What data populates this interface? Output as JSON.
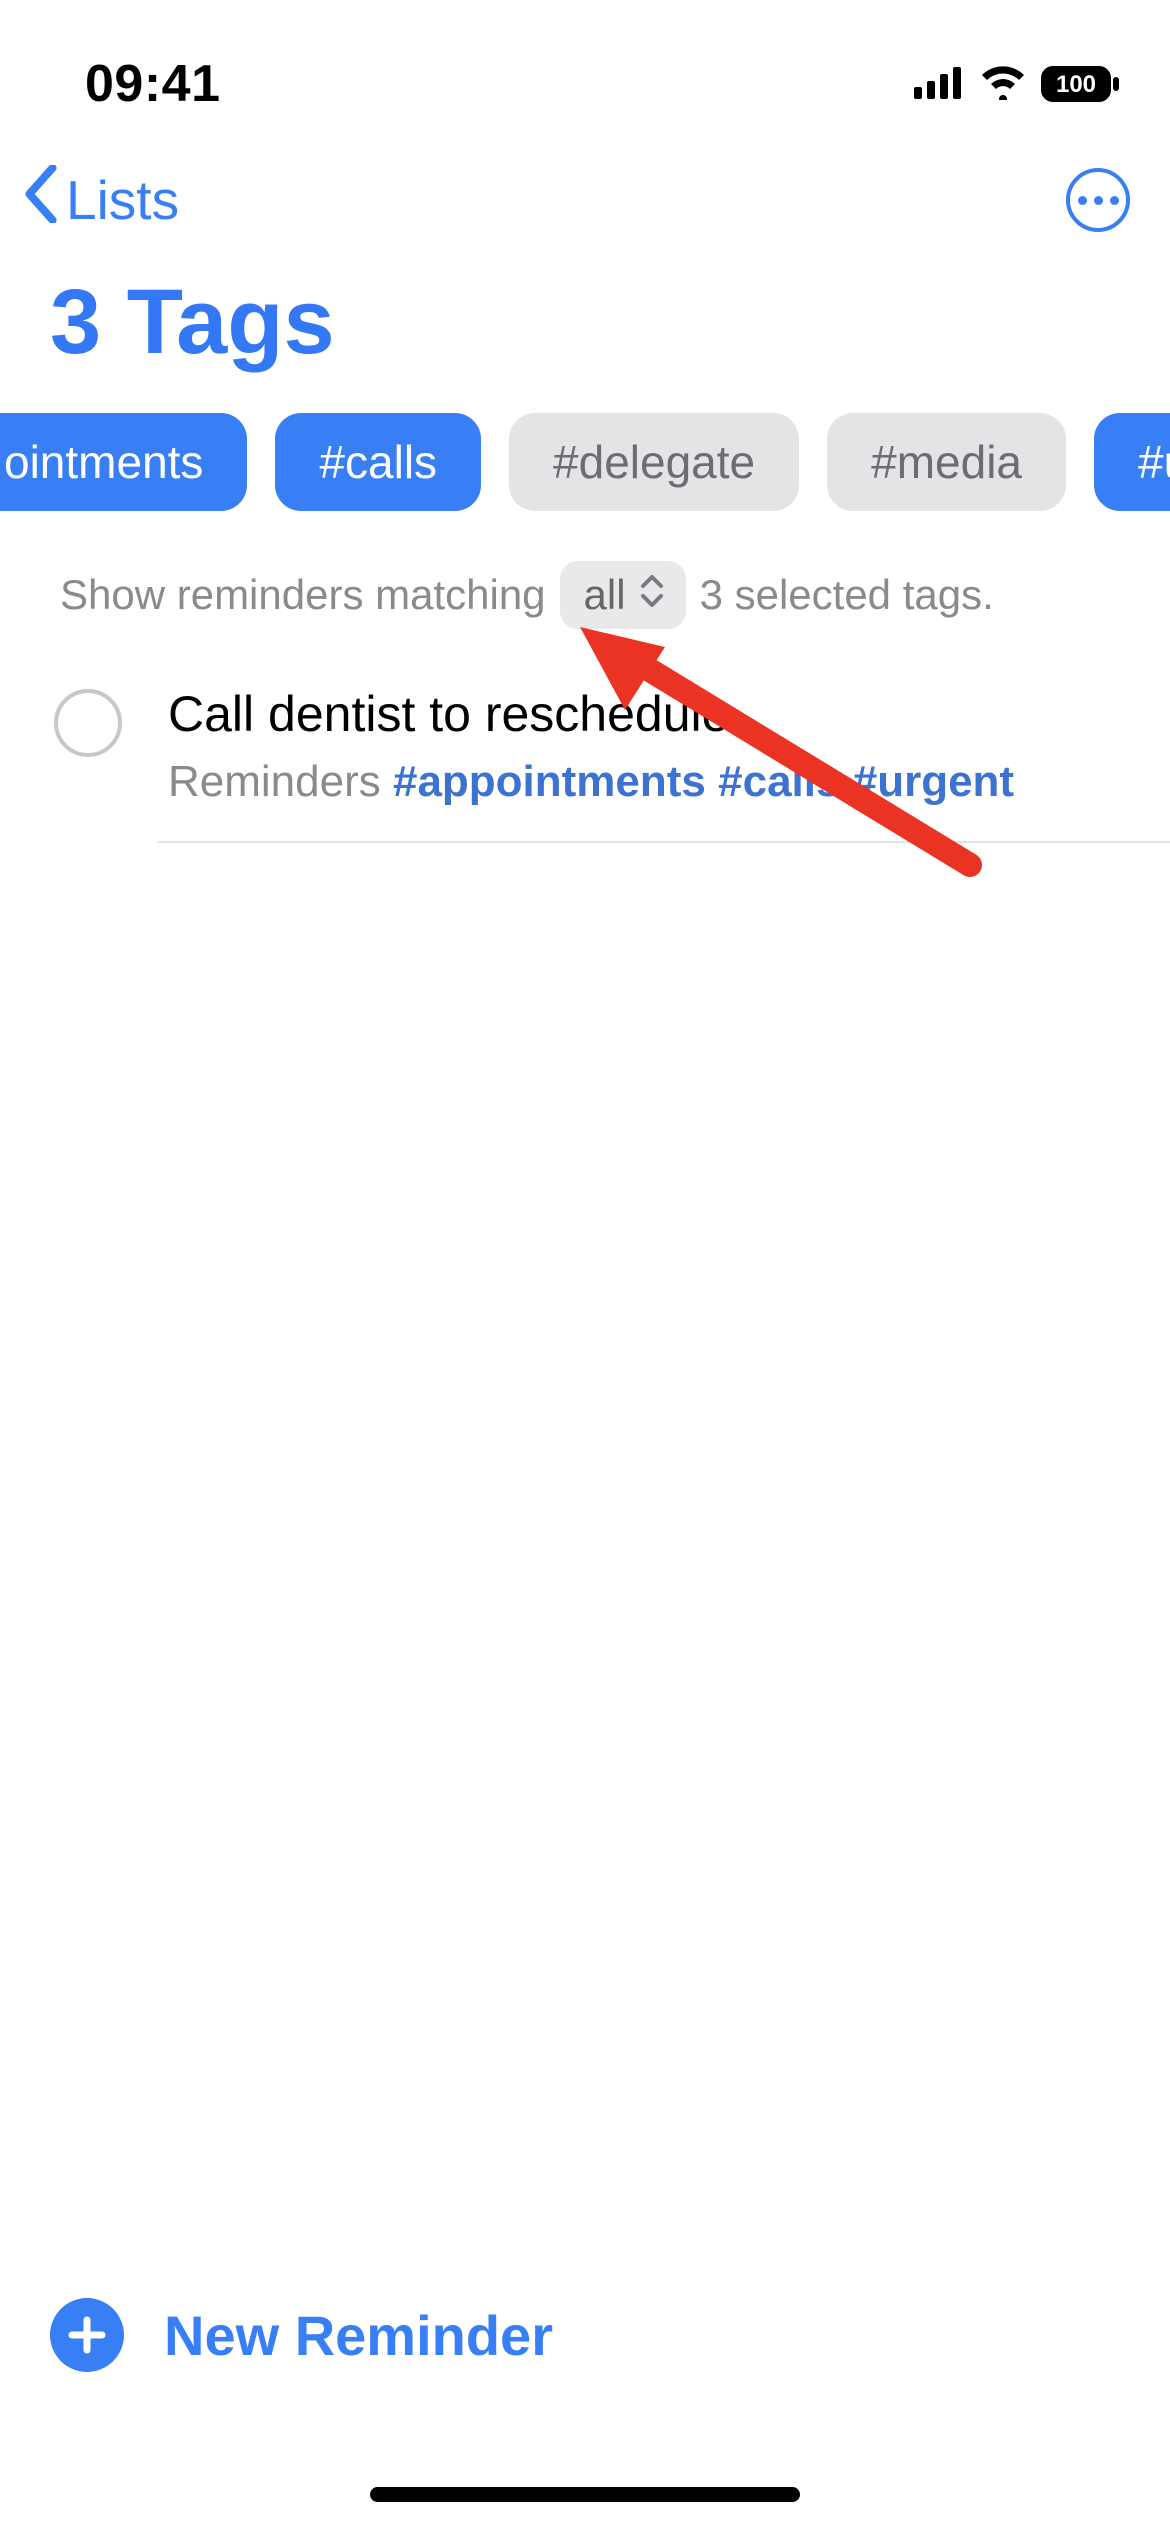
{
  "status": {
    "time": "09:41",
    "battery": "100"
  },
  "nav": {
    "back_label": "Lists"
  },
  "title": "3 Tags",
  "tags": [
    {
      "label": "ointments",
      "selected": true
    },
    {
      "label": "#calls",
      "selected": true
    },
    {
      "label": "#delegate",
      "selected": false
    },
    {
      "label": "#media",
      "selected": false
    },
    {
      "label": "#urgent",
      "selected": true
    }
  ],
  "filter": {
    "prefix": "Show reminders matching",
    "mode": "all",
    "suffix": "3 selected tags."
  },
  "reminders": [
    {
      "title": "Call dentist to reschedule",
      "list": "Reminders",
      "tags": [
        "#appointments",
        "#calls",
        "#urgent"
      ]
    }
  ],
  "footer": {
    "new_label": "New Reminder"
  }
}
